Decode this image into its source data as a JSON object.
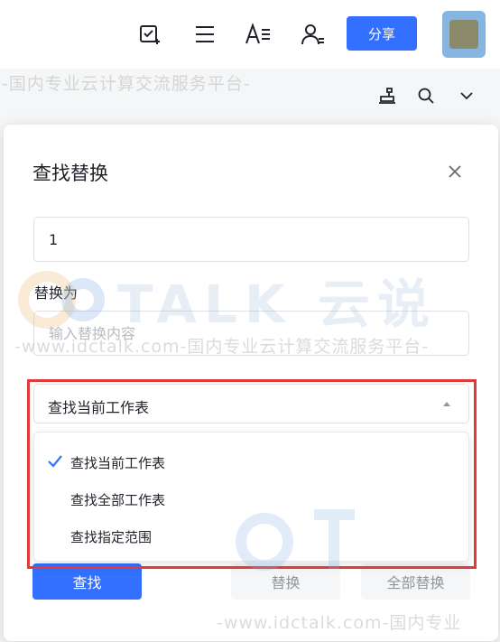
{
  "toolbar": {
    "share_label": "分享",
    "icons": [
      "checklist-icon",
      "list-icon",
      "text-format-icon",
      "user-manage-icon"
    ]
  },
  "subbar": {
    "icons": [
      "stamp-icon",
      "search-icon",
      "chevron-down-icon"
    ]
  },
  "dialog": {
    "title": "查找替换",
    "find_value": "1",
    "replace_label": "替换为",
    "replace_placeholder": "输入替换内容",
    "scope_selected": "查找当前工作表",
    "scope_options": [
      {
        "label": "查找当前工作表",
        "selected": true
      },
      {
        "label": "查找全部工作表",
        "selected": false
      },
      {
        "label": "查找指定范围",
        "selected": false
      }
    ],
    "find_button": "查找",
    "replace_button": "替换",
    "replace_all_button": "全部替换"
  },
  "watermark": {
    "brand_text": "TALK 云说",
    "slogan_1": "-国内专业云计算交流服务平台-",
    "slogan_2": "-www.idctalk.com-国内专业云计算交流服务平台-",
    "slogan_3": "-www.idctalk.com-国内专业"
  },
  "colors": {
    "accent": "#3370ff",
    "highlight_border": "#e03a3a"
  }
}
